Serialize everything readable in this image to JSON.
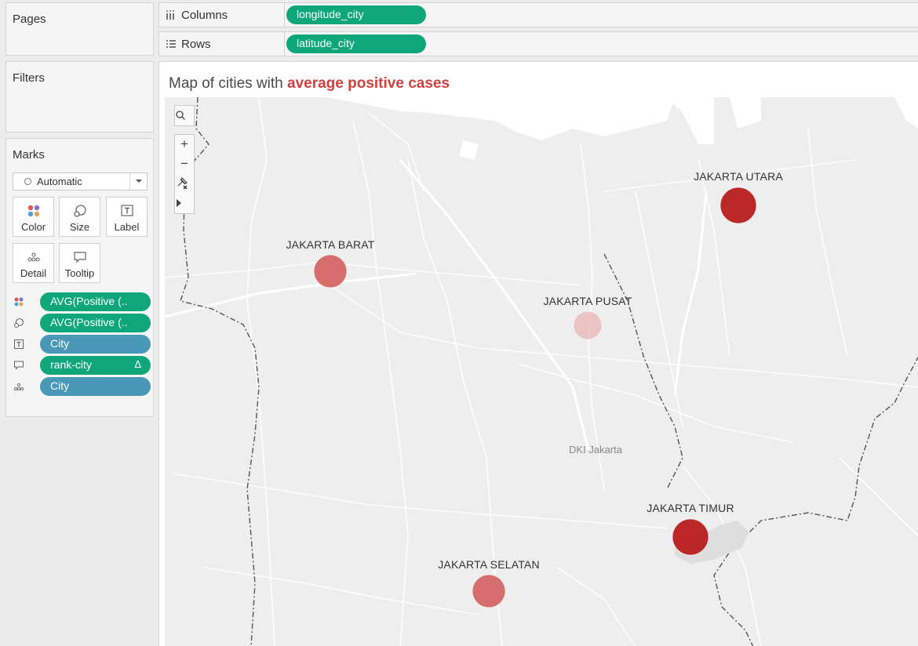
{
  "cards": {
    "pages_title": "Pages",
    "filters_title": "Filters",
    "marks_title": "Marks"
  },
  "marks": {
    "type": "Automatic",
    "buttons": [
      "Color",
      "Size",
      "Label",
      "Detail",
      "Tooltip"
    ],
    "fields": [
      {
        "icon": "color-icon",
        "label": "AVG(Positive (..",
        "color": "green"
      },
      {
        "icon": "size-icon",
        "label": "AVG(Positive (..",
        "color": "green"
      },
      {
        "icon": "label-icon",
        "label": "City",
        "color": "blue"
      },
      {
        "icon": "tooltip-icon",
        "label": "rank-city",
        "color": "green",
        "delta": "Δ"
      },
      {
        "icon": "detail-icon",
        "label": "City",
        "color": "blue"
      }
    ]
  },
  "shelves": {
    "columns_label": "Columns",
    "columns_pill": "longitude_city",
    "rows_label": "Rows",
    "rows_pill": "latitude_city"
  },
  "view": {
    "title_prefix": "Map of cities with ",
    "title_highlight": "average positive cases",
    "region_label": "DKI Jakarta"
  },
  "map_tools": [
    "search-icon",
    "zoom-in-icon",
    "zoom-out-icon",
    "pin-icon",
    "expand-icon"
  ],
  "cities": [
    {
      "name": "JAKARTA UTARA",
      "intensity": "high",
      "color": "#b71c1c"
    },
    {
      "name": "JAKARTA BARAT",
      "intensity": "medium",
      "color": "#d35f5f"
    },
    {
      "name": "JAKARTA PUSAT",
      "intensity": "low",
      "color": "#e8b4b4"
    },
    {
      "name": "JAKARTA TIMUR",
      "intensity": "high",
      "color": "#b71c1c"
    },
    {
      "name": "JAKARTA SELATAN",
      "intensity": "medium",
      "color": "#d35f5f"
    }
  ],
  "colors": {
    "pill_green": "#0fa77a",
    "pill_blue": "#4a98b7",
    "title_highlight": "#d0403e"
  }
}
